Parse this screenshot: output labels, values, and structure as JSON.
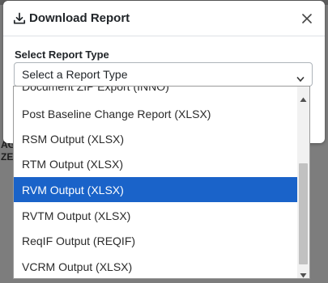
{
  "dialog": {
    "title": "Download Report",
    "field_label": "Select Report Type",
    "select_value": "Select a Report Type"
  },
  "dropdown": {
    "options": [
      "Document ZIP Export (INNO)",
      "Post Baseline Change Report (XLSX)",
      "RSM Output (XLSX)",
      "RTM Output (XLSX)",
      "RVM Output (XLSX)",
      "RVTM Output (XLSX)",
      "ReqIF Output (REQIF)",
      "VCRM Output (XLSX)"
    ],
    "selected": "RVM Output (XLSX)"
  },
  "icons": {
    "header": "download-icon",
    "close": "close-icon",
    "caret": "caret-down-icon",
    "scroll_up": "scroll-up-icon",
    "scroll_down": "scroll-down-icon"
  },
  "colors": {
    "selected_bg": "#1a63c9",
    "overlay": "#7d7d7d"
  },
  "background_fragments": [
    "AG",
    "ZE"
  ]
}
